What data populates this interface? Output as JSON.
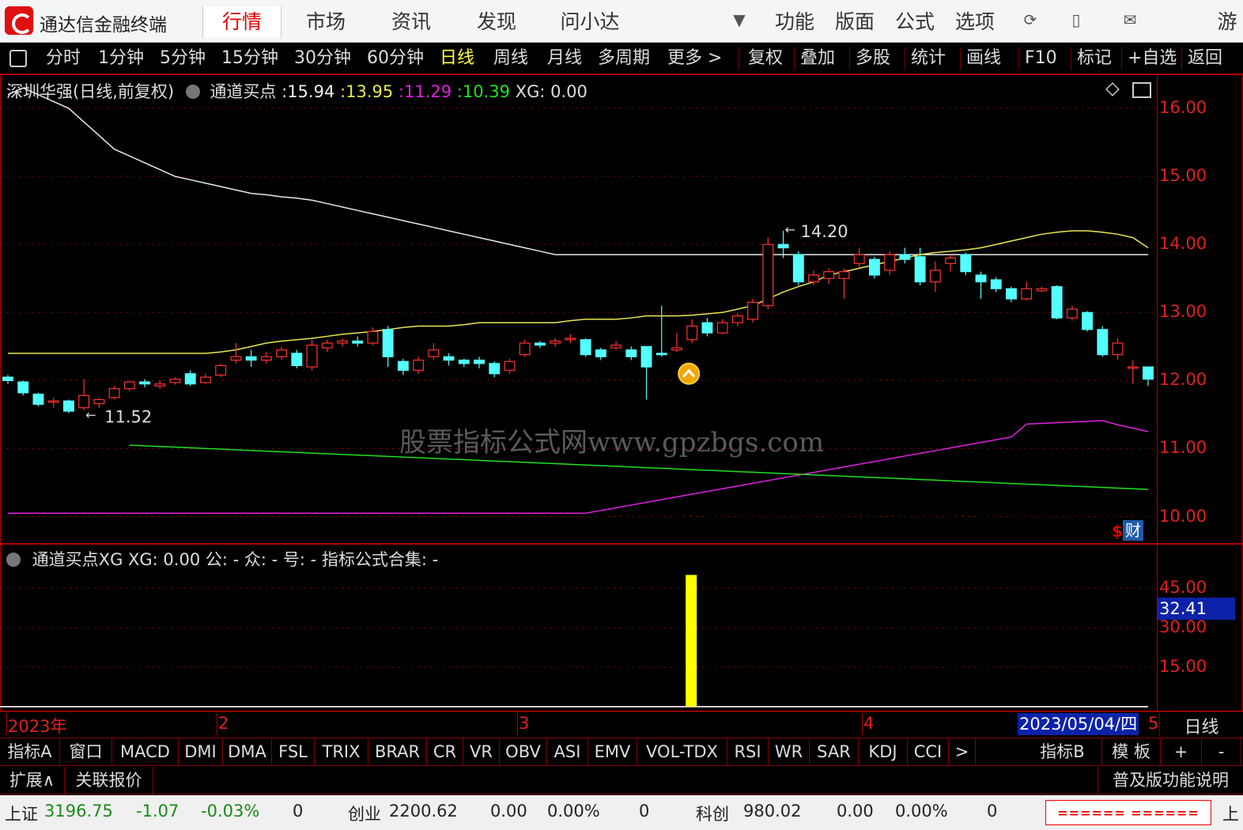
{
  "app": {
    "title": "通达信金融终端",
    "user": "游客"
  },
  "main_tabs": [
    "行情",
    "市场",
    "资讯",
    "发现",
    "问小达"
  ],
  "right_menu": [
    "功能",
    "版面",
    "公式",
    "选项"
  ],
  "periods": [
    "分时",
    "1分钟",
    "5分钟",
    "15分钟",
    "30分钟",
    "60分钟",
    "日线",
    "周线",
    "月线",
    "多周期",
    "更多 >"
  ],
  "period_active": "日线",
  "tools": [
    "复权",
    "叠加",
    "多股",
    "统计",
    "画线",
    "F10",
    "标记",
    "+自选",
    "返回"
  ],
  "main_chart": {
    "stock": "深圳华强(日线,前复权)",
    "indicator": "通道买点",
    "v1": ":15.94",
    "v2": ":13.95",
    "v3": ":11.29",
    "v4": ":10.39",
    "xg": "XG: 0.00",
    "high_label": "14.20",
    "low_label": "11.52",
    "y_ticks": [
      "16.00",
      "15.00",
      "14.00",
      "13.00",
      "12.00",
      "11.00",
      "10.00"
    ],
    "watermark": "股票指标公式网www.gpzbgs.com",
    "badge": "财",
    "colors": {
      "upper": "#e8e8e8",
      "mid": "#e8e850",
      "lower_magenta": "#e020e0",
      "lower_green": "#20e020",
      "up": "#ff3232",
      "down": "#54ffff"
    }
  },
  "sub_chart": {
    "title": "通道买点XG  XG: 0.00  公: -  众: -  号: -  指标公式合集: -",
    "y_ticks": [
      "45.00",
      "30.00",
      "15.00"
    ],
    "cursor_value": "32.41"
  },
  "x_axis": {
    "labels": [
      "2023年",
      "2",
      "3",
      "4"
    ],
    "date_box": "2023/05/04/四",
    "tail": "5",
    "period": "日线"
  },
  "bottom_tabs": [
    "指标A",
    "窗口",
    "MACD",
    "DMI",
    "DMA",
    "FSL",
    "TRIX",
    "BRAR",
    "CR",
    "VR",
    "OBV",
    "ASI",
    "EMV",
    "VOL-TDX",
    "RSI",
    "WR",
    "SAR",
    "KDJ",
    "CCI",
    ">",
    "指标B",
    "模 板",
    "+",
    "-"
  ],
  "ext": {
    "expand": "扩展∧",
    "related": "关联报价",
    "help": "普及版功能说明"
  },
  "status": {
    "sh": {
      "name": "上证",
      "value": "3196.75",
      "chg": "-1.07",
      "pct": "-0.03%",
      "vol": "0"
    },
    "cy": {
      "name": "创业",
      "value": "2200.62",
      "chg": "0.00",
      "pct": "0.00%",
      "vol": "0"
    },
    "kc": {
      "name": "科创",
      "value": "980.02",
      "chg": "0.00",
      "pct": "0.00%",
      "vol": "0"
    },
    "tail": "上"
  },
  "chart_data": {
    "type": "candlestick",
    "title": "深圳华强(日线,前复权)",
    "ylim": [
      9.6,
      16.5
    ],
    "candles": [
      [
        12.05,
        12.0,
        12.08,
        11.95
      ],
      [
        11.98,
        11.82,
        12.0,
        11.78
      ],
      [
        11.8,
        11.65,
        11.82,
        11.62
      ],
      [
        11.68,
        11.7,
        11.75,
        11.6
      ],
      [
        11.7,
        11.55,
        11.72,
        11.52
      ],
      [
        11.6,
        11.78,
        12.02,
        11.56
      ],
      [
        11.66,
        11.72,
        11.75,
        11.6
      ],
      [
        11.75,
        11.88,
        11.92,
        11.72
      ],
      [
        11.88,
        11.98,
        12.0,
        11.85
      ],
      [
        11.98,
        11.95,
        12.02,
        11.9
      ],
      [
        11.92,
        11.95,
        12.0,
        11.88
      ],
      [
        11.97,
        12.02,
        12.05,
        11.94
      ],
      [
        12.1,
        11.95,
        12.15,
        11.92
      ],
      [
        11.97,
        12.05,
        12.1,
        11.95
      ],
      [
        12.08,
        12.22,
        12.25,
        12.05
      ],
      [
        12.3,
        12.35,
        12.55,
        12.25
      ],
      [
        12.35,
        12.3,
        12.45,
        12.2
      ],
      [
        12.3,
        12.35,
        12.42,
        12.25
      ],
      [
        12.35,
        12.45,
        12.5,
        12.3
      ],
      [
        12.4,
        12.22,
        12.45,
        12.18
      ],
      [
        12.2,
        12.52,
        12.6,
        12.15
      ],
      [
        12.48,
        12.55,
        12.6,
        12.42
      ],
      [
        12.55,
        12.58,
        12.62,
        12.5
      ],
      [
        12.58,
        12.55,
        12.65,
        12.5
      ],
      [
        12.55,
        12.72,
        12.78,
        12.52
      ],
      [
        12.75,
        12.35,
        12.8,
        12.2
      ],
      [
        12.28,
        12.15,
        12.32,
        12.08
      ],
      [
        12.15,
        12.3,
        12.35,
        12.1
      ],
      [
        12.35,
        12.45,
        12.55,
        12.3
      ],
      [
        12.35,
        12.3,
        12.4,
        12.22
      ],
      [
        12.3,
        12.25,
        12.32,
        12.2
      ],
      [
        12.3,
        12.25,
        12.35,
        12.18
      ],
      [
        12.25,
        12.1,
        12.28,
        12.05
      ],
      [
        12.15,
        12.28,
        12.32,
        12.1
      ],
      [
        12.38,
        12.55,
        12.6,
        12.35
      ],
      [
        12.55,
        12.52,
        12.58,
        12.48
      ],
      [
        12.55,
        12.58,
        12.62,
        12.5
      ],
      [
        12.6,
        12.62,
        12.68,
        12.55
      ],
      [
        12.6,
        12.38,
        12.62,
        12.35
      ],
      [
        12.45,
        12.35,
        12.48,
        12.3
      ],
      [
        12.48,
        12.52,
        12.58,
        12.45
      ],
      [
        12.45,
        12.35,
        12.5,
        12.3
      ],
      [
        12.5,
        12.2,
        12.5,
        11.72
      ],
      [
        12.4,
        12.38,
        13.1,
        12.35
      ],
      [
        12.45,
        12.48,
        12.7,
        12.42
      ],
      [
        12.6,
        12.8,
        12.9,
        12.55
      ],
      [
        12.85,
        12.7,
        12.92,
        12.65
      ],
      [
        12.7,
        12.85,
        12.9,
        12.68
      ],
      [
        12.85,
        12.95,
        13.0,
        12.8
      ],
      [
        12.9,
        13.15,
        13.2,
        12.85
      ],
      [
        13.1,
        14.0,
        14.1,
        13.05
      ],
      [
        14.0,
        13.95,
        14.2,
        13.8
      ],
      [
        13.85,
        13.45,
        13.9,
        13.4
      ],
      [
        13.45,
        13.55,
        13.62,
        13.4
      ],
      [
        13.5,
        13.6,
        13.65,
        13.42
      ],
      [
        13.5,
        13.6,
        13.65,
        13.2
      ],
      [
        13.72,
        13.85,
        13.95,
        13.65
      ],
      [
        13.78,
        13.55,
        13.82,
        13.5
      ],
      [
        13.62,
        13.85,
        13.9,
        13.55
      ],
      [
        13.85,
        13.78,
        13.95,
        13.72
      ],
      [
        13.82,
        13.45,
        13.95,
        13.4
      ],
      [
        13.45,
        13.62,
        13.75,
        13.3
      ],
      [
        13.72,
        13.8,
        13.85,
        13.6
      ],
      [
        13.85,
        13.6,
        13.88,
        13.55
      ],
      [
        13.55,
        13.45,
        13.6,
        13.2
      ],
      [
        13.48,
        13.35,
        13.52,
        13.3
      ],
      [
        13.35,
        13.2,
        13.38,
        13.15
      ],
      [
        13.2,
        13.35,
        13.45,
        13.18
      ],
      [
        13.32,
        13.35,
        13.38,
        13.3
      ],
      [
        13.38,
        12.92,
        13.4,
        12.9
      ],
      [
        12.92,
        13.05,
        13.1,
        12.88
      ],
      [
        13.0,
        12.75,
        13.02,
        12.72
      ],
      [
        12.75,
        12.38,
        12.8,
        12.35
      ],
      [
        12.38,
        12.55,
        12.62,
        12.3
      ],
      [
        12.18,
        12.2,
        12.3,
        11.95
      ],
      [
        12.2,
        12.02,
        12.2,
        11.92
      ]
    ],
    "series": [
      {
        "name": "upper",
        "values": [
          16.2,
          16.3,
          16.2,
          16.1,
          16.0,
          15.8,
          15.6,
          15.4,
          15.3,
          15.2,
          15.1,
          15.0,
          14.95,
          14.9,
          14.85,
          14.8,
          14.75,
          14.73,
          14.7,
          14.68,
          14.65,
          14.6,
          14.55,
          14.5,
          14.45,
          14.4,
          14.35,
          14.3,
          14.25,
          14.2,
          14.15,
          14.1,
          14.05,
          14.0,
          13.95,
          13.9,
          13.85,
          13.85,
          13.85,
          13.85,
          13.85,
          13.85,
          13.85,
          13.85,
          13.85,
          13.85,
          13.85,
          13.85,
          13.85,
          13.85,
          13.85,
          13.85,
          13.85,
          13.85,
          13.85,
          13.85,
          13.85,
          13.85,
          13.85,
          13.85,
          13.85,
          13.85,
          13.85,
          13.85,
          13.85,
          13.85,
          13.85,
          13.85,
          13.85,
          13.85,
          13.85,
          13.85,
          13.85,
          13.85,
          13.85,
          13.85
        ]
      },
      {
        "name": "mid",
        "values": [
          12.4,
          12.4,
          12.4,
          12.4,
          12.4,
          12.4,
          12.4,
          12.4,
          12.4,
          12.4,
          12.4,
          12.4,
          12.4,
          12.4,
          12.42,
          12.45,
          12.5,
          12.55,
          12.58,
          12.6,
          12.62,
          12.65,
          12.68,
          12.7,
          12.72,
          12.75,
          12.78,
          12.8,
          12.8,
          12.8,
          12.82,
          12.85,
          12.85,
          12.85,
          12.85,
          12.85,
          12.85,
          12.88,
          12.9,
          12.9,
          12.9,
          12.92,
          12.95,
          12.95,
          12.95,
          12.96,
          12.98,
          13.0,
          13.05,
          13.1,
          13.2,
          13.3,
          13.38,
          13.45,
          13.55,
          13.6,
          13.65,
          13.7,
          13.75,
          13.8,
          13.85,
          13.88,
          13.9,
          13.92,
          13.95,
          14.0,
          14.05,
          14.1,
          14.15,
          14.18,
          14.2,
          14.2,
          14.18,
          14.15,
          14.1,
          13.95
        ]
      }
    ]
  }
}
